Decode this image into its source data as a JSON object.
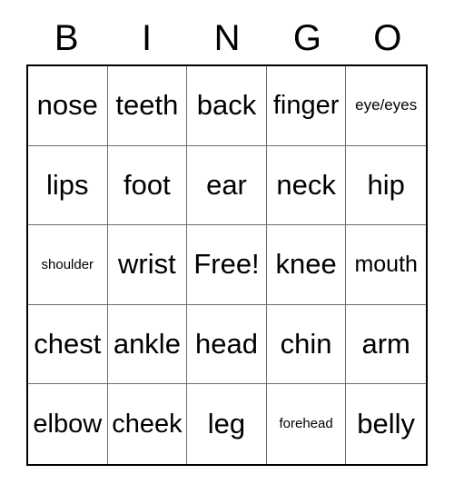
{
  "card": {
    "headers": [
      "B",
      "I",
      "N",
      "G",
      "O"
    ],
    "rows": [
      [
        {
          "label": "nose",
          "size": "fs-xl"
        },
        {
          "label": "teeth",
          "size": "fs-xl"
        },
        {
          "label": "back",
          "size": "fs-xl"
        },
        {
          "label": "finger",
          "size": "fs-lg"
        },
        {
          "label": "eye/eyes",
          "size": "fs-sm"
        }
      ],
      [
        {
          "label": "lips",
          "size": "fs-xl"
        },
        {
          "label": "foot",
          "size": "fs-xl"
        },
        {
          "label": "ear",
          "size": "fs-xl"
        },
        {
          "label": "neck",
          "size": "fs-xl"
        },
        {
          "label": "hip",
          "size": "fs-xl"
        }
      ],
      [
        {
          "label": "shoulder",
          "size": "fs-xs"
        },
        {
          "label": "wrist",
          "size": "fs-xl"
        },
        {
          "label": "Free!",
          "size": "fs-xl"
        },
        {
          "label": "knee",
          "size": "fs-xl"
        },
        {
          "label": "mouth",
          "size": "fs-md"
        }
      ],
      [
        {
          "label": "chest",
          "size": "fs-xl"
        },
        {
          "label": "ankle",
          "size": "fs-xl"
        },
        {
          "label": "head",
          "size": "fs-xl"
        },
        {
          "label": "chin",
          "size": "fs-xl"
        },
        {
          "label": "arm",
          "size": "fs-xl"
        }
      ],
      [
        {
          "label": "elbow",
          "size": "fs-lg"
        },
        {
          "label": "cheek",
          "size": "fs-lg"
        },
        {
          "label": "leg",
          "size": "fs-xl"
        },
        {
          "label": "forehead",
          "size": "fs-xs"
        },
        {
          "label": "belly",
          "size": "fs-xl"
        }
      ]
    ]
  },
  "colors": {
    "outer_border": "#000000",
    "inner_grid_line": "#6e6e6e",
    "text": "#000000",
    "background": "#ffffff"
  }
}
